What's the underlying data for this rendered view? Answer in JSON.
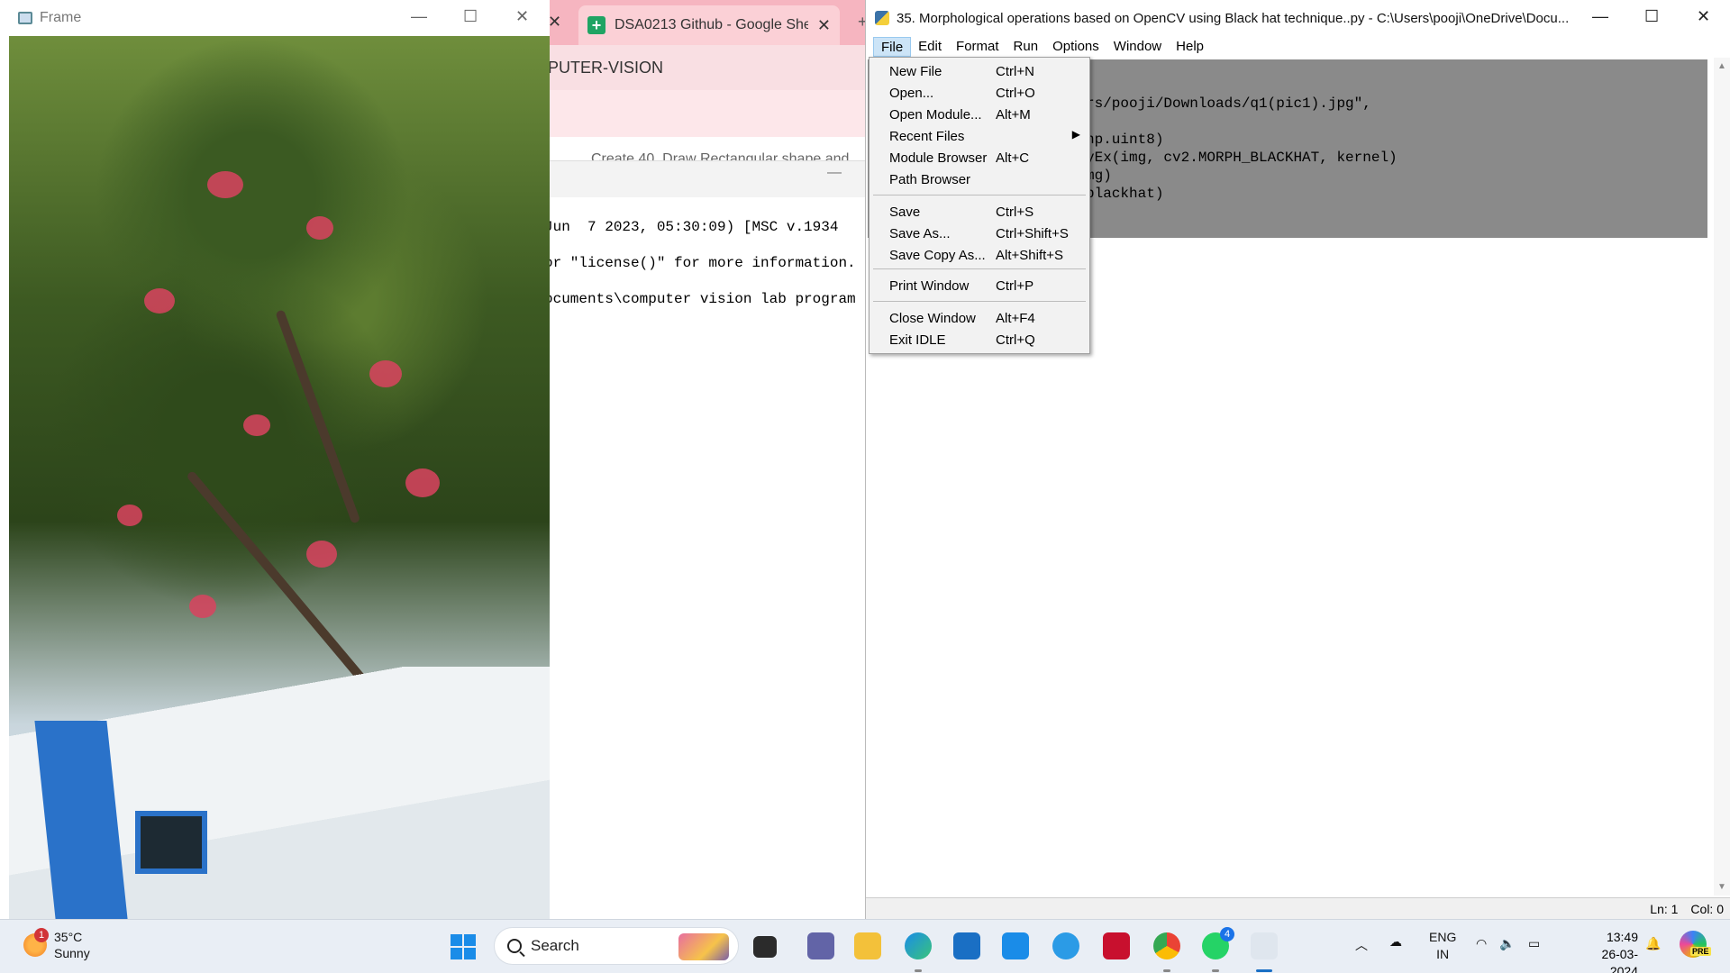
{
  "browser": {
    "tab_title": "DSA0213 Github - Google Shee",
    "toolbar_text": "PUTER-VISION",
    "cut_text": "Create 40. Draw Rectangular shape and"
  },
  "shell": {
    "lines": [
      "Jun  7 2023, 05:30:09) [MSC v.1934",
      "or \"license()\" for more information.",
      "ocuments\\computer vision lab program"
    ]
  },
  "frame": {
    "title": "Frame"
  },
  "editor": {
    "title": "35. Morphological operations based on OpenCV using Black hat technique..py - C:\\Users\\pooji\\OneDrive\\Docu...",
    "menus": [
      "File",
      "Edit",
      "Format",
      "Run",
      "Options",
      "Window",
      "Help"
    ],
    "code_lines": [
      "rs/pooji/Downloads/q1(pic1).jpg\",",
      "np.uint8)",
      "yEx(img, cv2.MORPH_BLACKHAT, kernel)",
      "mg)",
      "blackhat)"
    ],
    "status_line": "Ln: 1",
    "status_col": "Col: 0"
  },
  "file_menu": {
    "items": [
      {
        "label": "New File",
        "accel": "Ctrl+N"
      },
      {
        "label": "Open...",
        "accel": "Ctrl+O"
      },
      {
        "label": "Open Module...",
        "accel": "Alt+M"
      },
      {
        "label": "Recent Files",
        "accel": ""
      },
      {
        "label": "Module Browser",
        "accel": "Alt+C"
      },
      {
        "label": "Path Browser",
        "accel": ""
      },
      {
        "label": "Save",
        "accel": "Ctrl+S"
      },
      {
        "label": "Save As...",
        "accel": "Ctrl+Shift+S"
      },
      {
        "label": "Save Copy As...",
        "accel": "Alt+Shift+S"
      },
      {
        "label": "Print Window",
        "accel": "Ctrl+P"
      },
      {
        "label": "Close Window",
        "accel": "Alt+F4"
      },
      {
        "label": "Exit IDLE",
        "accel": "Ctrl+Q"
      }
    ]
  },
  "taskbar": {
    "weather_badge": "1",
    "temperature": "35°C",
    "condition": "Sunny",
    "search_label": "Search",
    "whatsapp_badge": "4",
    "lang_top": "ENG",
    "lang_bottom": "IN",
    "time": "13:49",
    "date": "26-03-2024",
    "copilot_badge": "PRE",
    "icons": [
      "task-view-icon",
      "teams-icon",
      "file-explorer-icon",
      "edge-icon",
      "microsoft-store-icon",
      "myhp-icon",
      "help-icon",
      "mcafee-icon",
      "chrome-icon",
      "whatsapp-icon",
      "python-idle-icon"
    ]
  },
  "colors": {
    "selection_gray": "#8a8a8a",
    "menu_highlight": "#cce4f7",
    "browser_tab_pink": "#f6b5c0",
    "taskbar_bg": "#e9eef5"
  }
}
